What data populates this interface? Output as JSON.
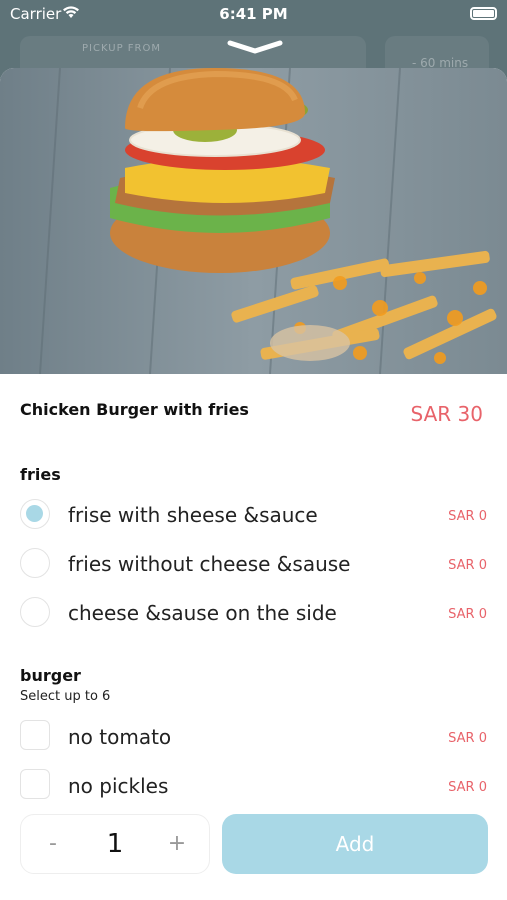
{
  "status_bar": {
    "carrier": "Carrier",
    "time": "6:41 PM"
  },
  "background": {
    "pickup_label": "PICKUP FROM",
    "time_label": "- 60 mins"
  },
  "item": {
    "title": "Chicken Burger with fries",
    "price": "SAR 30"
  },
  "groups": [
    {
      "title": "fries",
      "subtitle": "",
      "type": "radio",
      "options": [
        {
          "label": "frise with sheese &sauce",
          "price": "SAR 0",
          "selected": true
        },
        {
          "label": "fries without cheese &sause",
          "price": "SAR 0",
          "selected": false
        },
        {
          "label": "cheese &sause on the side",
          "price": "SAR 0",
          "selected": false
        }
      ]
    },
    {
      "title": "burger",
      "subtitle": "Select up to 6",
      "type": "checkbox",
      "options": [
        {
          "label": "no tomato",
          "price": "SAR 0",
          "selected": false
        },
        {
          "label": "no pickles",
          "price": "SAR 0",
          "selected": false
        }
      ]
    }
  ],
  "quantity": {
    "minus": "-",
    "value": "1",
    "plus": "+"
  },
  "add_label": "Add",
  "colors": {
    "accent": "#a9d8e6",
    "price": "#e8636a",
    "background_app": "#5e7378"
  },
  "icons": {
    "wifi": "wifi-icon",
    "battery": "battery-icon",
    "handle": "chevron-down-icon"
  }
}
